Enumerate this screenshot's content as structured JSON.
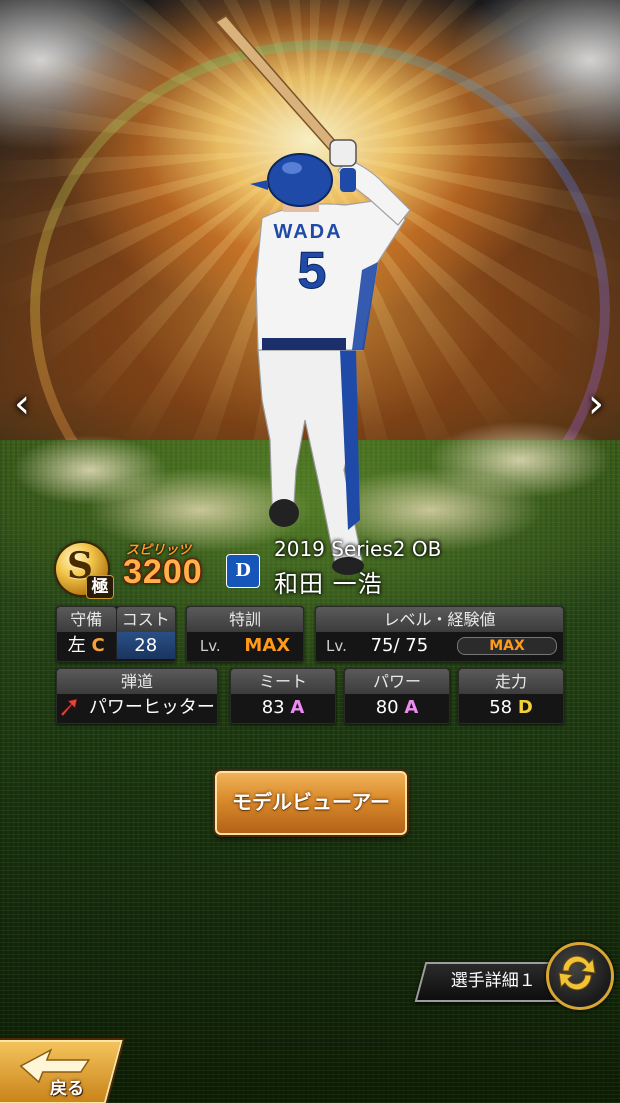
{
  "card": {
    "rank_letter": "S",
    "rank_sub": "極",
    "spirits_label": "スピリッツ",
    "spirits_value": "3200",
    "team_logo_text": "D",
    "series": "2019 Series2 OB",
    "player_name": "和田 一浩",
    "uniform_name": "WADA",
    "uniform_number": "5"
  },
  "stats": {
    "defense": {
      "label": "守備",
      "position": "左",
      "grade": "C"
    },
    "cost": {
      "label": "コスト",
      "value": "28"
    },
    "training": {
      "label": "特訓",
      "lv_prefix": "Lv.",
      "value": "MAX"
    },
    "level": {
      "label": "レベル・経験値",
      "lv_prefix": "Lv.",
      "value": "75/ 75",
      "bar_label": "MAX",
      "exp_fraction": 1.0
    },
    "trajectory": {
      "label": "弾道",
      "value": "パワーヒッター"
    },
    "meet": {
      "label": "ミート",
      "value": "83",
      "grade": "A"
    },
    "power": {
      "label": "パワー",
      "value": "80",
      "grade": "A"
    },
    "speed": {
      "label": "走力",
      "value": "58",
      "grade": "D"
    }
  },
  "buttons": {
    "model_viewer": "モデルビューアー",
    "player_detail": "選手詳細１",
    "back": "戻る"
  },
  "nav": {
    "prev": "‹",
    "next": "›"
  },
  "colors": {
    "grade_A": "#ee8bf0",
    "grade_C": "#f7a23a",
    "grade_D": "#f3cf3a",
    "accent_orange": "#ff9a1a",
    "team_blue": "#1556b8"
  }
}
